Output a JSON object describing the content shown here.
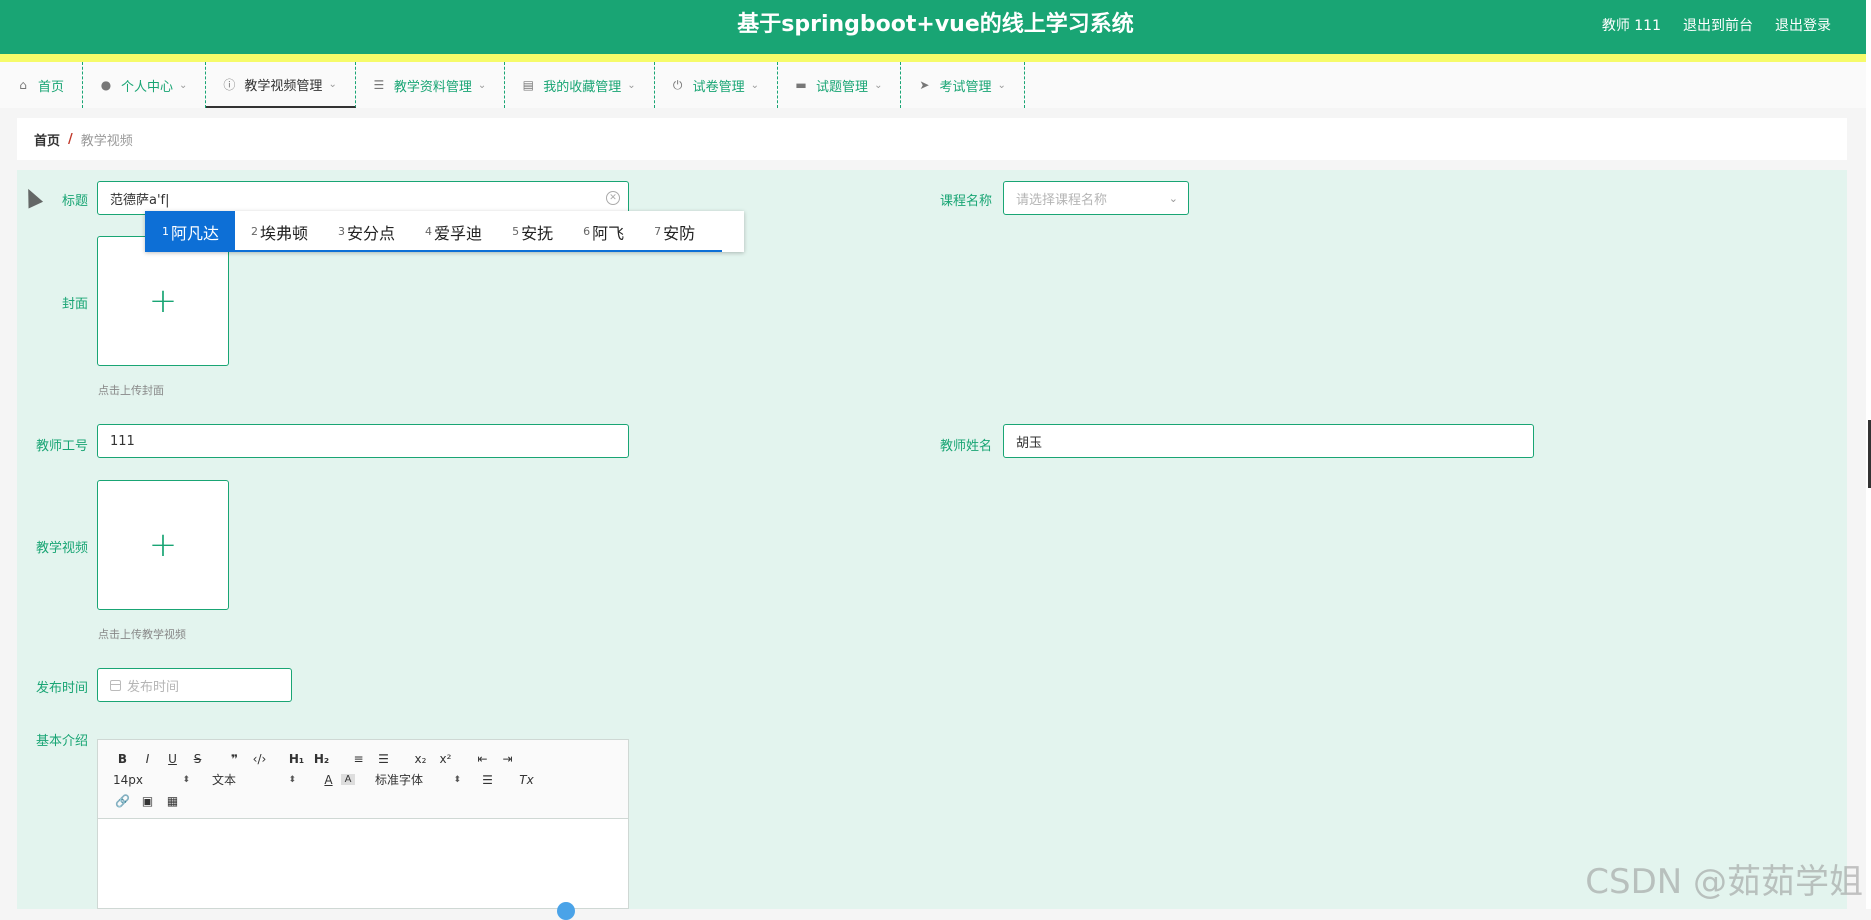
{
  "header": {
    "title": "基于springboot+vue的线上学习系统",
    "user": "教师 111",
    "back_to_front": "退出到前台",
    "logout": "退出登录"
  },
  "nav": {
    "items": [
      {
        "label": "首页",
        "icon": "home-icon"
      },
      {
        "label": "个人中心",
        "icon": "user-icon"
      },
      {
        "label": "教学视频管理",
        "icon": "info-icon"
      },
      {
        "label": "教学资料管理",
        "icon": "list-icon"
      },
      {
        "label": "我的收藏管理",
        "icon": "clipboard-icon"
      },
      {
        "label": "试卷管理",
        "icon": "power-icon"
      },
      {
        "label": "试题管理",
        "icon": "tray-icon"
      },
      {
        "label": "考试管理",
        "icon": "send-icon"
      }
    ]
  },
  "breadcrumb": {
    "home": "首页",
    "separator": "/",
    "current": "教学视频"
  },
  "form": {
    "title_label": "标题",
    "title_value": "范德萨a'f|",
    "course_label": "课程名称",
    "course_placeholder": "请选择课程名称",
    "cover_label": "封面",
    "cover_tip": "点击上传封面",
    "teacher_id_label": "教师工号",
    "teacher_id_value": "111",
    "teacher_name_label": "教师姓名",
    "teacher_name_value": "胡玉",
    "video_label": "教学视频",
    "video_tip": "点击上传教学视频",
    "publish_label": "发布时间",
    "publish_placeholder": "发布时间",
    "intro_label": "基本介绍"
  },
  "ime": {
    "candidates": [
      {
        "num": "1",
        "text": "阿凡达"
      },
      {
        "num": "2",
        "text": "埃弗顿"
      },
      {
        "num": "3",
        "text": "安分点"
      },
      {
        "num": "4",
        "text": "爱孚迪"
      },
      {
        "num": "5",
        "text": "安抚"
      },
      {
        "num": "6",
        "text": "阿飞"
      },
      {
        "num": "7",
        "text": "安防"
      }
    ]
  },
  "editor": {
    "font_size": "14px",
    "paragraph": "文本",
    "font_family": "标准字体"
  },
  "watermark": "CSDN @茹茹学姐",
  "colors": {
    "accent": "#19a574",
    "stripe": "#f6fb6a",
    "form_bg": "#e3f4ee",
    "ime_select": "#0d6fd6"
  }
}
